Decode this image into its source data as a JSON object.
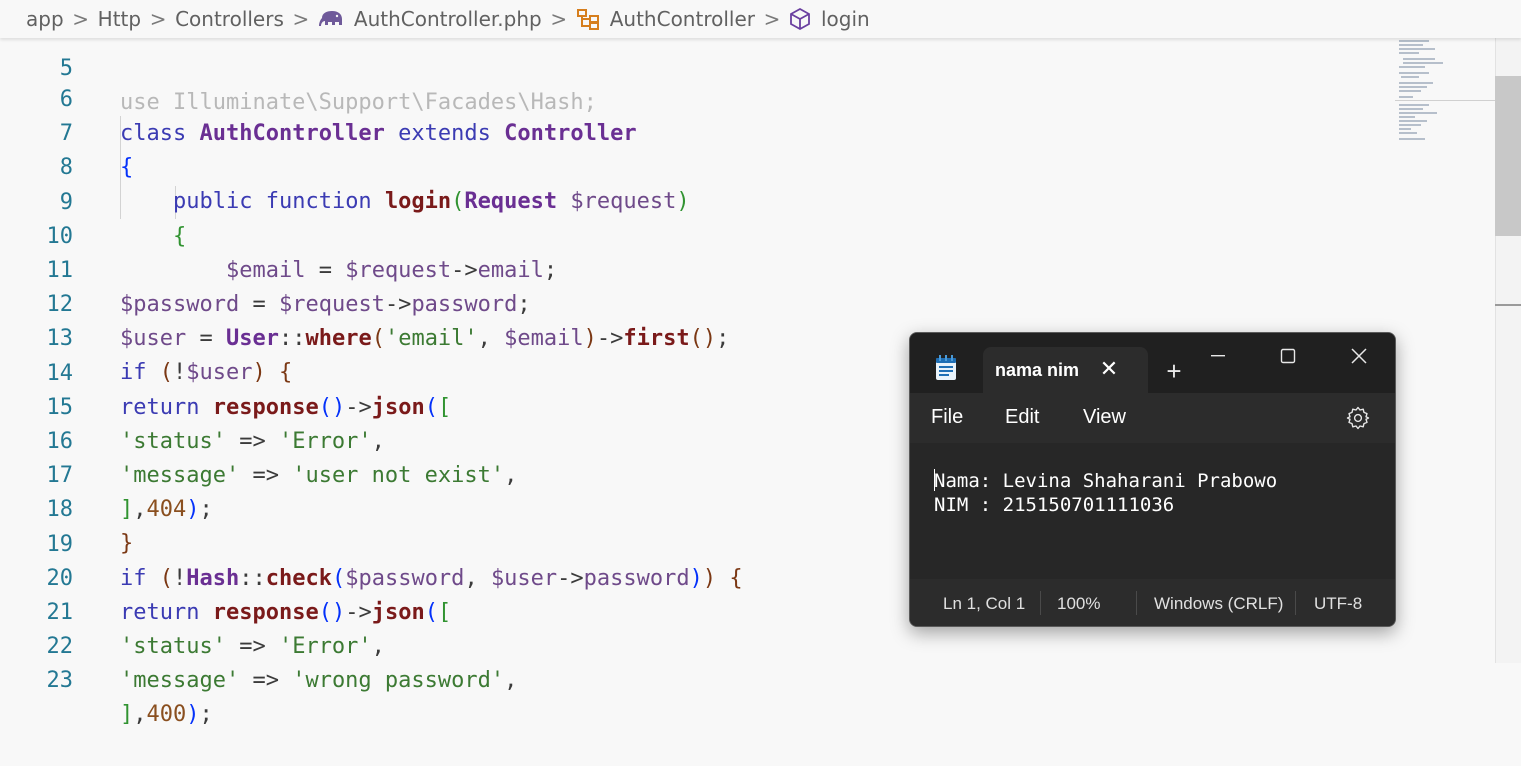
{
  "breadcrumb": {
    "items": [
      {
        "label": "app"
      },
      {
        "label": "Http"
      },
      {
        "label": "Controllers"
      },
      {
        "label": "AuthController.php"
      },
      {
        "label": "AuthController"
      },
      {
        "label": "login"
      }
    ],
    "separator": ">"
  },
  "editor": {
    "partial_line_text": "use Illuminate\\Support\\Facades\\Hash;",
    "line_numbers": [
      "5",
      "6",
      "7",
      "8",
      "9",
      "10",
      "11",
      "12",
      "13",
      "14",
      "15",
      "16",
      "17",
      "18",
      "19",
      "20",
      "21",
      "22",
      "23"
    ],
    "tokens": {
      "class": "class",
      "extends": "extends",
      "public": "public",
      "function": "function",
      "if": "if",
      "return": "return",
      "AuthController": "AuthController",
      "Controller": "Controller",
      "login": "login",
      "Request": "Request",
      "User": "User",
      "Hash": "Hash",
      "where": "where",
      "first": "first",
      "check": "check",
      "response": "response",
      "json": "json",
      "request": "$request",
      "email": "$email",
      "password": "$password",
      "user": "$user",
      "prop_email": "email",
      "prop_password": "password",
      "str_email": "'email'",
      "str_status": "'status'",
      "str_message": "'message'",
      "str_error": "'Error'",
      "str_not_exist": "'user not exist'",
      "str_wrong_password": "'wrong password'",
      "num_404": "404",
      "num_400": "400"
    }
  },
  "notepad": {
    "tab_title": "nama nim",
    "menu": {
      "file": "File",
      "edit": "Edit",
      "view": "View"
    },
    "content": [
      "Nama: Levina Shaharani Prabowo",
      "NIM : 215150701111036"
    ],
    "status": {
      "position": "Ln 1, Col 1",
      "zoom": "100%",
      "line_ending": "Windows (CRLF)",
      "encoding": "UTF-8"
    }
  },
  "colors": {
    "keyword": "#3b3bb3",
    "class_name": "#6a2f93",
    "function_name": "#7a1a1a",
    "variable": "#6f4a8a",
    "string": "#3c7a33",
    "number": "#8a4f1f",
    "line_number": "#237893",
    "notepad_bg": "#202020"
  },
  "icons": {
    "php_file": "elephant-icon",
    "class_symbol": "class-icon",
    "method_symbol": "cube-icon",
    "notepad_app": "notepad-icon",
    "settings": "gear-icon"
  }
}
